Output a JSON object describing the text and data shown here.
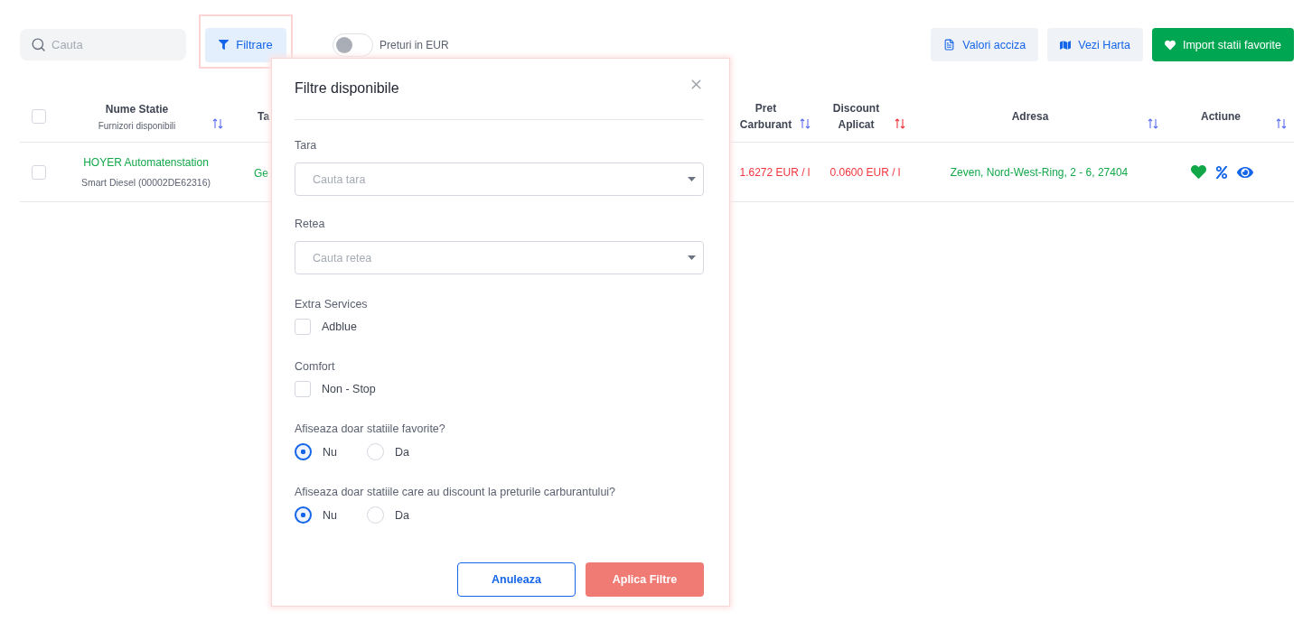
{
  "toolbar": {
    "search": {
      "placeholder": "Cauta"
    },
    "filter_button": {
      "label": "Filtrare",
      "active": true
    },
    "eur_toggle": {
      "label": "Preturi in EUR",
      "on": false
    },
    "buttons": [
      {
        "kind": "excise",
        "label": "Valori acciza"
      },
      {
        "kind": "map",
        "label": "Vezi Harta"
      },
      {
        "kind": "favorites",
        "label": "Import statii favorite"
      }
    ]
  },
  "table": {
    "select_all": {
      "checked": false
    },
    "columns": [
      {
        "kind": "name",
        "title": "Nume Statie",
        "subtitle": "Furnizori disponibili",
        "sort_active": false
      },
      {
        "kind": "country",
        "title": "Ta"
      },
      {
        "kind": "price",
        "title": "Pret Carburant",
        "sort_active": false
      },
      {
        "kind": "discount",
        "title": "Discount Aplicat",
        "sort_active": true
      },
      {
        "kind": "address",
        "title": "Adresa",
        "sort_active": false
      },
      {
        "kind": "actions",
        "title": "Actiune",
        "sort_active": false
      }
    ],
    "rows": [
      {
        "checked": false,
        "name": "HOYER Automatenstation",
        "supplier": "Smart Diesel (00002DE62316)",
        "country": "Ge",
        "price": "1.6272 EUR / l",
        "discount": "0.0600 EUR / l",
        "address": "Zeven, Nord-West-Ring, 2 - 6, 27404",
        "favorite": true
      }
    ]
  },
  "filter_panel": {
    "title": "Filtre disponibile",
    "selects": [
      {
        "label": "Tara",
        "placeholder": "Cauta tara"
      },
      {
        "label": "Retea",
        "placeholder": "Cauta retea"
      }
    ],
    "checkbox_groups": [
      {
        "label": "Extra Services",
        "options": [
          {
            "label": "Adblue",
            "checked": false
          }
        ]
      },
      {
        "label": "Comfort",
        "options": [
          {
            "label": "Non - Stop",
            "checked": false
          }
        ]
      }
    ],
    "radio_groups": [
      {
        "label": "Afiseaza doar statiile favorite?",
        "options": [
          {
            "label": "Nu",
            "selected": true
          },
          {
            "label": "Da",
            "selected": false
          }
        ]
      },
      {
        "label": "Afiseaza doar statiile care au discount la preturile carburantului?",
        "options": [
          {
            "label": "Nu",
            "selected": true
          },
          {
            "label": "Da",
            "selected": false
          }
        ]
      }
    ],
    "cancel": "Anuleaza",
    "apply": "Aplica Filtre"
  }
}
